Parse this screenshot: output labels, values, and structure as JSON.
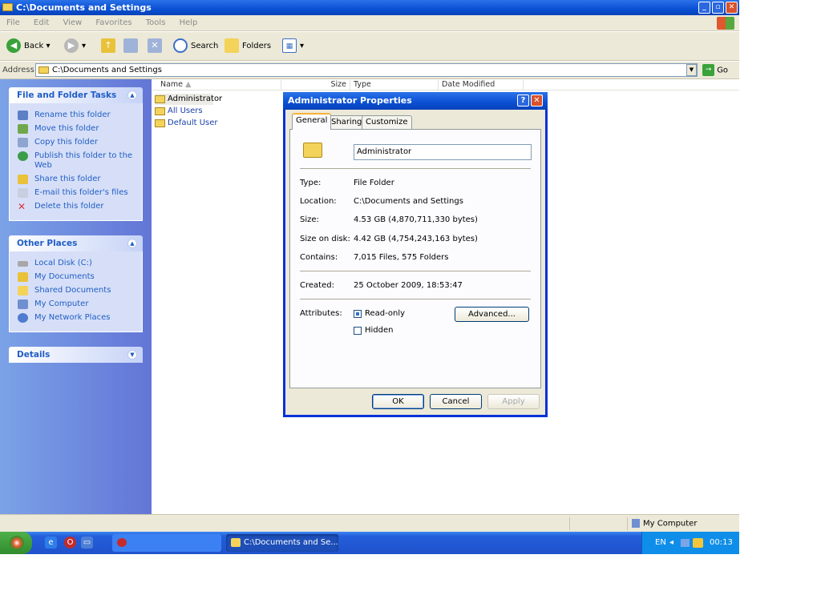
{
  "window": {
    "title": "C:\\Documents and Settings"
  },
  "menu": [
    "File",
    "Edit",
    "View",
    "Favorites",
    "Tools",
    "Help"
  ],
  "toolbar": {
    "back": "Back",
    "search": "Search",
    "folders": "Folders"
  },
  "address": {
    "label": "Address",
    "value": "C:\\Documents and Settings",
    "go": "Go"
  },
  "tasks_panel": {
    "title": "File and Folder Tasks",
    "items": [
      "Rename this folder",
      "Move this folder",
      "Copy this folder",
      "Publish this folder to the Web",
      "Share this folder",
      "E-mail this folder's files",
      "Delete this folder"
    ]
  },
  "places_panel": {
    "title": "Other Places",
    "items": [
      "Local Disk (C:)",
      "My Documents",
      "Shared Documents",
      "My Computer",
      "My Network Places"
    ]
  },
  "details_panel": {
    "title": "Details"
  },
  "columns": [
    "Name",
    "Size",
    "Type",
    "Date Modified"
  ],
  "files": [
    "Administrator",
    "All Users",
    "Default User"
  ],
  "status": {
    "location": "My Computer"
  },
  "taskbar": {
    "tasks": [
      "C:\\Documents and Se..."
    ],
    "tray_lang": "EN",
    "clock": "00:13"
  },
  "dialog": {
    "title": "Administrator Properties",
    "tabs": [
      "General",
      "Sharing",
      "Customize"
    ],
    "name": "Administrator",
    "props": {
      "type_label": "Type:",
      "type": "File Folder",
      "location_label": "Location:",
      "location": "C:\\Documents and Settings",
      "size_label": "Size:",
      "size": "4.53 GB (4,870,711,330 bytes)",
      "sizeondisk_label": "Size on disk:",
      "sizeondisk": "4.42 GB (4,754,243,163 bytes)",
      "contains_label": "Contains:",
      "contains": "7,015 Files, 575 Folders",
      "created_label": "Created:",
      "created": "25 October 2009, 18:53:47",
      "attributes_label": "Attributes:"
    },
    "attributes": {
      "readonly": "Read-only",
      "hidden": "Hidden",
      "advanced": "Advanced..."
    },
    "buttons": {
      "ok": "OK",
      "cancel": "Cancel",
      "apply": "Apply"
    }
  }
}
